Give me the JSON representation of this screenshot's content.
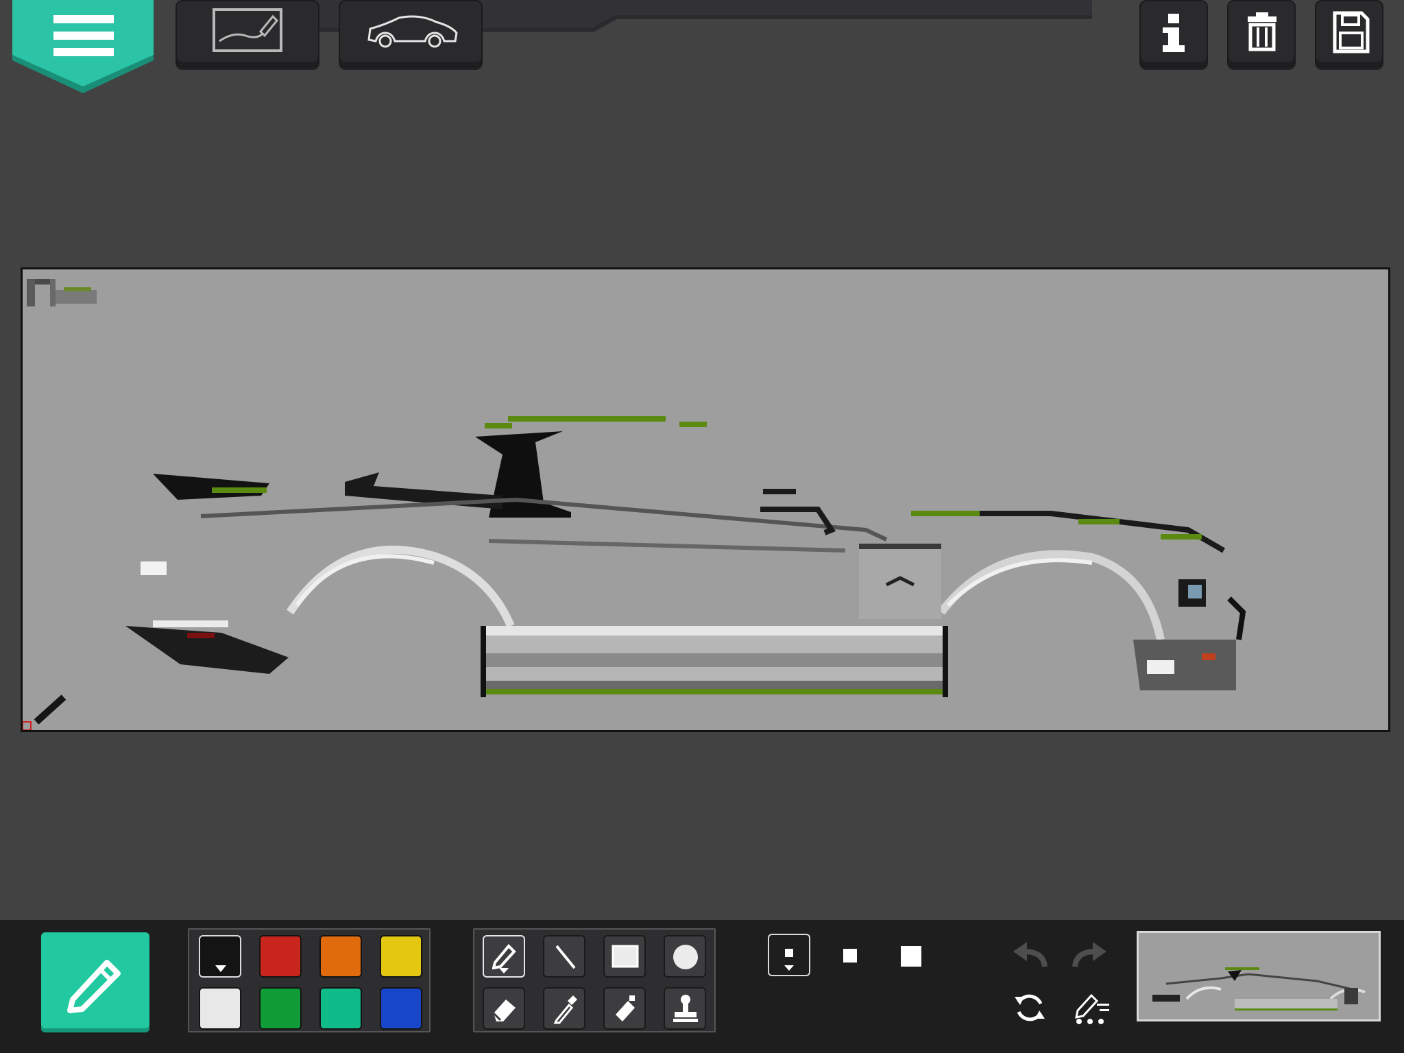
{
  "app": {
    "top_tools": [
      {
        "name": "draw-mode",
        "icon": "freehand-draw-icon"
      },
      {
        "name": "car-template",
        "icon": "car-outline-icon"
      }
    ],
    "top_right_buttons": [
      {
        "name": "info",
        "icon": "info-icon"
      },
      {
        "name": "delete",
        "icon": "trash-icon"
      },
      {
        "name": "save",
        "icon": "save-icon"
      }
    ]
  },
  "colors": {
    "accent": "#25c9a3",
    "canvas_background": "#9e9e9e",
    "app_background": "#424242",
    "bottom_bar": "#1e1e1e"
  },
  "palette": [
    {
      "color": "#141414",
      "selected": true
    },
    {
      "color": "#c8261c",
      "selected": false
    },
    {
      "color": "#e06b0c",
      "selected": false
    },
    {
      "color": "#e3c711",
      "selected": false
    },
    {
      "color": "#e8e8e8",
      "selected": false
    },
    {
      "color": "#0f9b36",
      "selected": false
    },
    {
      "color": "#0fbb88",
      "selected": false
    },
    {
      "color": "#1846c8",
      "selected": false
    }
  ],
  "tools": [
    {
      "name": "pencil",
      "icon": "pencil-icon",
      "active": true
    },
    {
      "name": "line",
      "icon": "line-icon",
      "active": false
    },
    {
      "name": "rectangle",
      "icon": "rectangle-icon",
      "active": false
    },
    {
      "name": "circle",
      "icon": "circle-icon",
      "active": false
    },
    {
      "name": "eraser",
      "icon": "eraser-icon",
      "active": false
    },
    {
      "name": "eyedropper",
      "icon": "eyedropper-icon",
      "active": false
    },
    {
      "name": "spray",
      "icon": "spray-can-icon",
      "active": false
    },
    {
      "name": "stamp",
      "icon": "stamp-icon",
      "active": false
    }
  ],
  "brush_sizes": [
    {
      "name": "small",
      "selected": true
    },
    {
      "name": "medium",
      "selected": false
    },
    {
      "name": "large",
      "selected": false
    }
  ],
  "history": {
    "undo_enabled": false,
    "redo_enabled": false
  },
  "current_tool": "pencil"
}
